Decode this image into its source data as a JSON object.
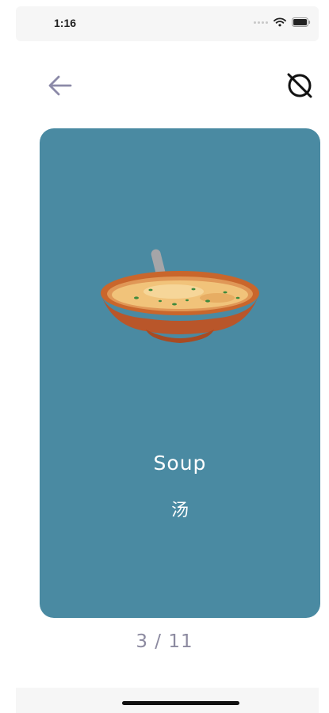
{
  "status_bar": {
    "time": "1:16"
  },
  "card": {
    "word_en": "Soup",
    "word_zh": "汤",
    "image": "soup-bowl-illustration",
    "background_color": "#4a8aa2"
  },
  "pagination": {
    "current": 3,
    "total": 11,
    "label": "3 / 11"
  },
  "icons": {
    "back": "arrow-left-icon",
    "toggle": "no-image-toggle-icon"
  }
}
